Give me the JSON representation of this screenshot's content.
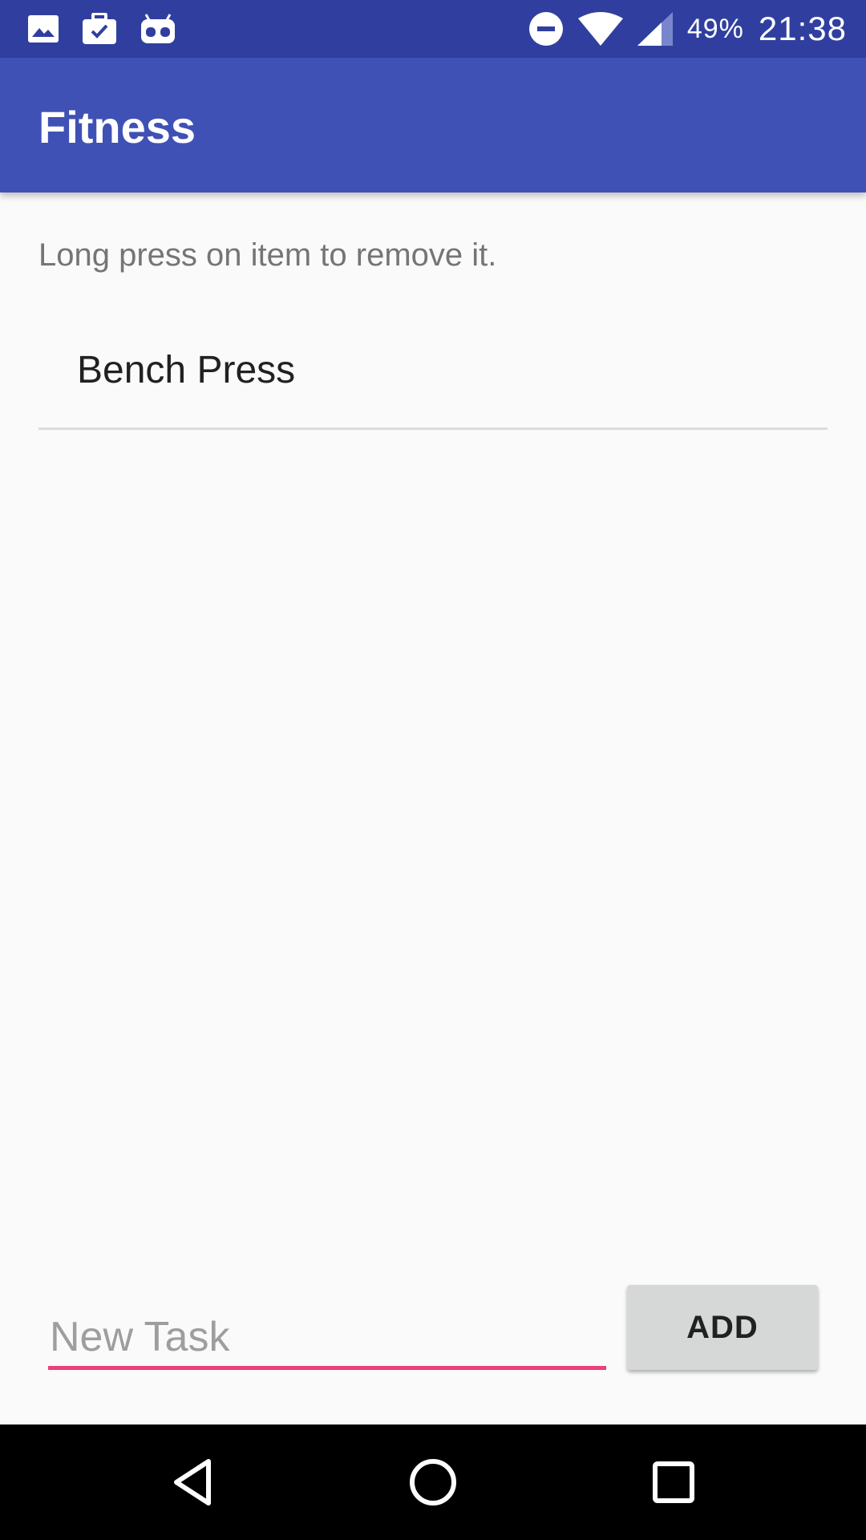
{
  "status_bar": {
    "icons_left": [
      "image-icon",
      "briefcase-check-icon",
      "android-robot-icon"
    ],
    "icons_right": [
      "do-not-disturb-icon",
      "wifi-icon",
      "cell-signal-icon"
    ],
    "battery": "49%",
    "time": "21:38",
    "background": "#303f9f"
  },
  "app_bar": {
    "title": "Fitness",
    "background": "#3f51b5"
  },
  "main": {
    "hint": "Long press on item to remove it.",
    "tasks": [
      {
        "label": "Bench Press"
      }
    ]
  },
  "input": {
    "placeholder": "New Task",
    "value": "",
    "underline_color": "#ec407a"
  },
  "add_button": {
    "label": "ADD"
  },
  "nav_bar": {
    "buttons": [
      "back-icon",
      "home-icon",
      "recents-icon"
    ]
  }
}
